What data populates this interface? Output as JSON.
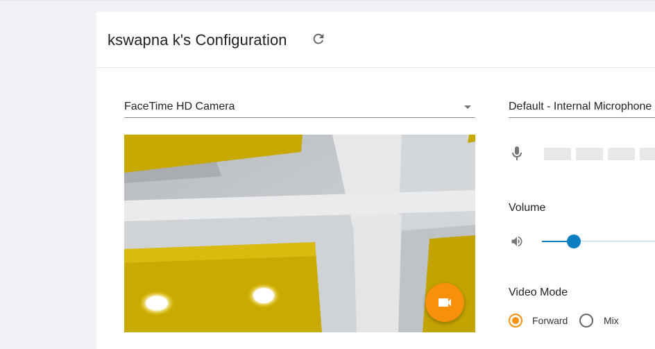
{
  "header": {
    "title": "kswapna k's Configuration",
    "refresh_icon": "refresh-icon"
  },
  "camera": {
    "selected": "FaceTime HD Camera"
  },
  "microphone": {
    "selected": "Default - Internal Microphone",
    "icon": "microphone-icon"
  },
  "volume": {
    "label": "Volume",
    "icon": "speaker-icon",
    "level": 0.28
  },
  "video_mode": {
    "label": "Video Mode",
    "options": [
      {
        "label": "Forward",
        "selected": true
      },
      {
        "label": "Mix",
        "selected": false
      }
    ]
  },
  "record_button": {
    "icon": "videocam-icon",
    "color": "#f7900a"
  },
  "colors": {
    "accent": "#f7900a",
    "slider": "#0a7fc2"
  }
}
